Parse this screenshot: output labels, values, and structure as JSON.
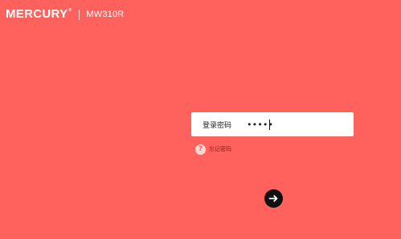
{
  "brand": {
    "logo_text": "MERCURY",
    "trademark": "®",
    "model": "MW310R"
  },
  "login": {
    "label": "登录密码",
    "password_mask": "•••••",
    "forgot_text": "忘记密码",
    "help_glyph": "?",
    "submit_icon": "arrow-right-icon"
  },
  "colors": {
    "background": "#ff625c",
    "input_background": "#ffffff",
    "button": "#111111"
  }
}
